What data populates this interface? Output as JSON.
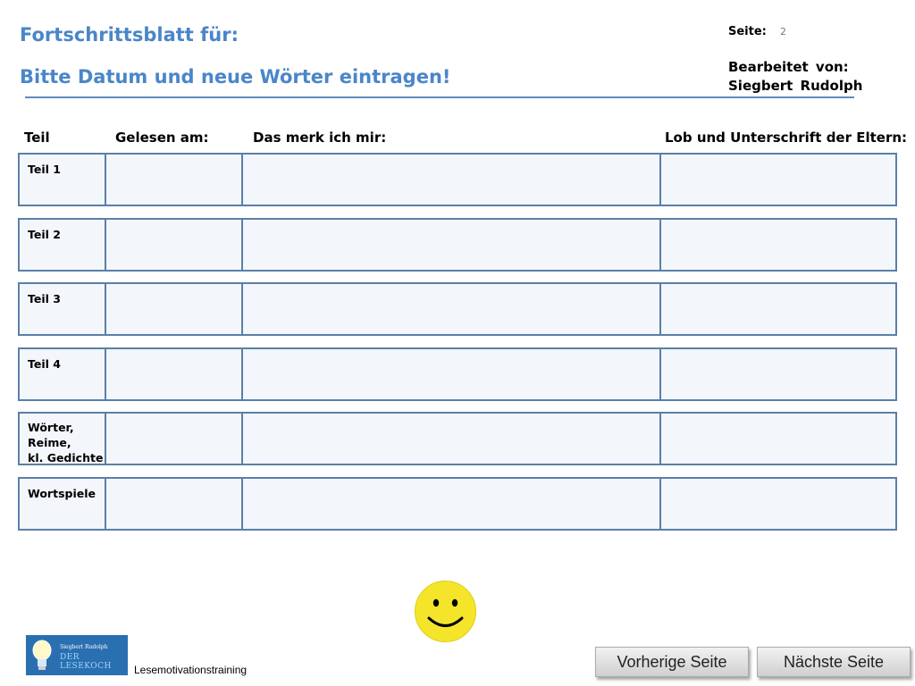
{
  "header": {
    "title": "Fortschrittsblatt für:",
    "subtitle": "Bitte Datum und neue Wörter eintragen!",
    "page_label": "Seite:",
    "page_number": "2",
    "editor_label": "Bearbeitet von:",
    "editor_name": "Siegbert Rudolph"
  },
  "table": {
    "columns": [
      "Teil",
      "Gelesen am:",
      "Das merk ich mir:",
      "Lob und Unterschrift der Eltern:"
    ],
    "rows": [
      {
        "label": "Teil 1"
      },
      {
        "label": "Teil 2"
      },
      {
        "label": "Teil 3"
      },
      {
        "label": "Teil 4"
      },
      {
        "label": "Wörter,\nReime,\nkl. Gedichte"
      },
      {
        "label": "Wortspiele"
      }
    ]
  },
  "footer": {
    "logo_author": "Siegbert Rudolph",
    "logo_brand": "DER LESEKOCH",
    "caption": "Lesemotivationstraining",
    "prev_button": "Vorherige Seite",
    "next_button": "Nächste Seite"
  },
  "icons": {
    "smiley": "smiley-face-icon"
  },
  "colors": {
    "heading": "#4a86c8",
    "border": "#5b7fa8",
    "smiley": "#f5e52a"
  }
}
